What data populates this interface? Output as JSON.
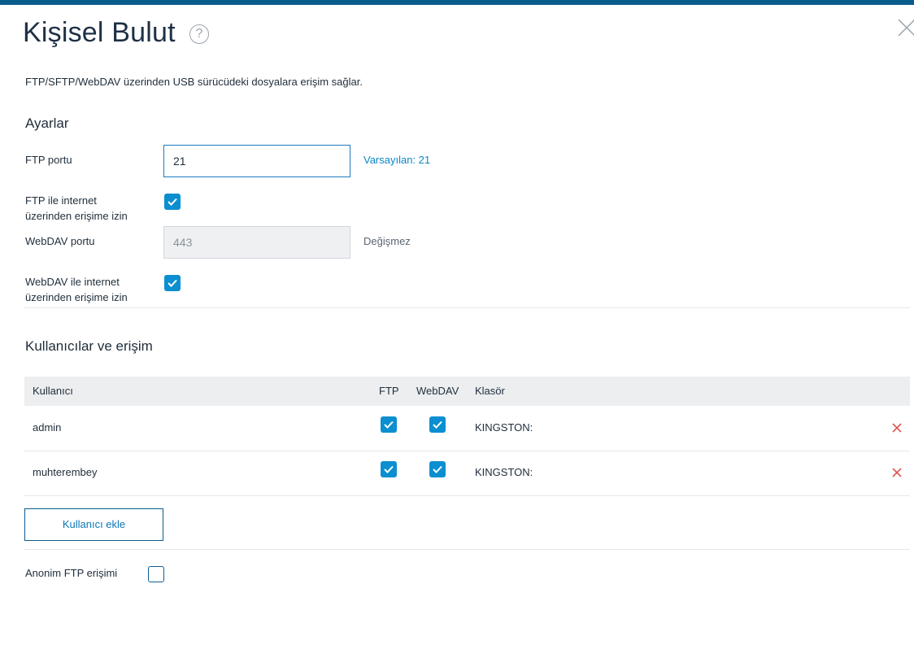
{
  "header": {
    "title": "Kişisel Bulut",
    "help_icon_glyph": "?"
  },
  "description": "FTP/SFTP/WebDAV üzerinden USB sürücüdeki dosyalara erişim sağlar.",
  "settings": {
    "heading": "Ayarlar",
    "ftp_port": {
      "label": "FTP portu",
      "value": "21",
      "hint": "Varsayılan: 21"
    },
    "ftp_internet": {
      "label_line1": "FTP ile internet",
      "label_line2": "üzerinden erişime izin",
      "checked": true
    },
    "webdav_port": {
      "label": "WebDAV portu",
      "value": "443",
      "hint": "Değişmez"
    },
    "webdav_internet": {
      "label_line1": "WebDAV ile internet",
      "label_line2": "üzerinden erişime izin",
      "checked": true
    }
  },
  "users": {
    "heading": "Kullanıcılar ve erişim",
    "columns": {
      "user": "Kullanıcı",
      "ftp": "FTP",
      "webdav": "WebDAV",
      "folder": "Klasör"
    },
    "rows": [
      {
        "name": "admin",
        "ftp": true,
        "webdav": true,
        "folder": "KINGSTON:"
      },
      {
        "name": "muhterembey",
        "ftp": true,
        "webdav": true,
        "folder": "KINGSTON:"
      }
    ],
    "add_button": "Kullanıcı ekle"
  },
  "anonymous_ftp": {
    "label": "Anonim FTP erişimi",
    "checked": false
  },
  "colors": {
    "accent": "#0b8fd0",
    "topbar": "#0a5c8c",
    "delete": "#e05555",
    "hint_blue": "#0b88c6"
  }
}
